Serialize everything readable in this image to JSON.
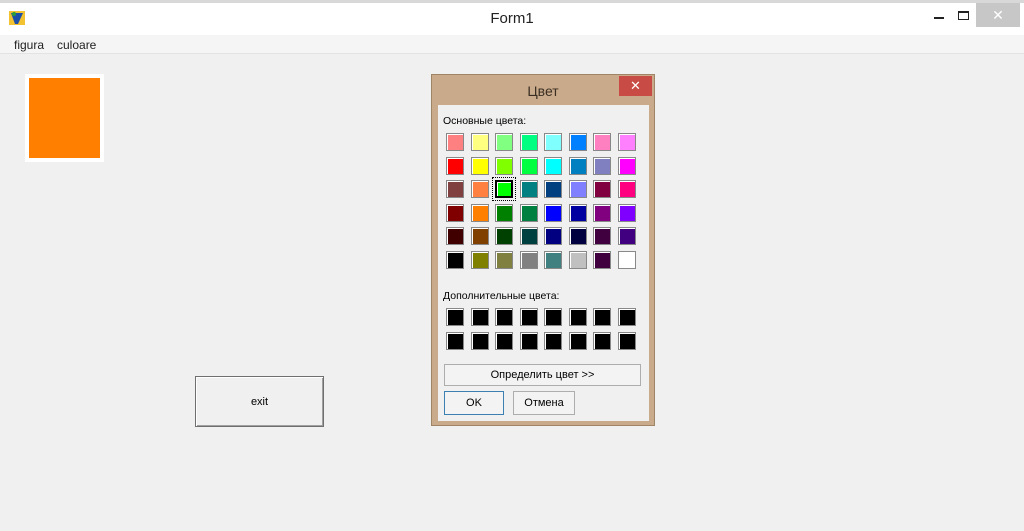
{
  "window": {
    "title": "Form1",
    "close_symbol": "✕"
  },
  "menu": {
    "items": [
      "figura",
      "culoare"
    ]
  },
  "shape": {
    "color": "#ff8000"
  },
  "exit_button": {
    "label": "exit"
  },
  "color_dialog": {
    "title": "Цвет",
    "close_symbol": "✕",
    "basic_label": "Основные цвета:",
    "custom_label": "Дополнительные цвета:",
    "define_label": "Определить цвет >>",
    "ok_label": "OK",
    "cancel_label": "Отмена",
    "selected_index": 18,
    "basic_colors": [
      "#ff8080",
      "#ffff80",
      "#80ff80",
      "#00ff80",
      "#80ffff",
      "#0080ff",
      "#ff80c0",
      "#ff80ff",
      "#ff0000",
      "#ffff00",
      "#80ff00",
      "#00ff40",
      "#00ffff",
      "#0080c0",
      "#8080c0",
      "#ff00ff",
      "#804040",
      "#ff8040",
      "#00ff00",
      "#008080",
      "#004080",
      "#8080ff",
      "#800040",
      "#ff0080",
      "#800000",
      "#ff8000",
      "#008000",
      "#008040",
      "#0000ff",
      "#0000a0",
      "#800080",
      "#8000ff",
      "#400000",
      "#804000",
      "#004000",
      "#004040",
      "#000080",
      "#000040",
      "#400040",
      "#400080",
      "#000000",
      "#808000",
      "#808040",
      "#808080",
      "#408080",
      "#c0c0c0",
      "#400040",
      "#ffffff"
    ],
    "custom_colors": [
      "#000000",
      "#000000",
      "#000000",
      "#000000",
      "#000000",
      "#000000",
      "#000000",
      "#000000",
      "#000000",
      "#000000",
      "#000000",
      "#000000",
      "#000000",
      "#000000",
      "#000000",
      "#000000"
    ]
  }
}
